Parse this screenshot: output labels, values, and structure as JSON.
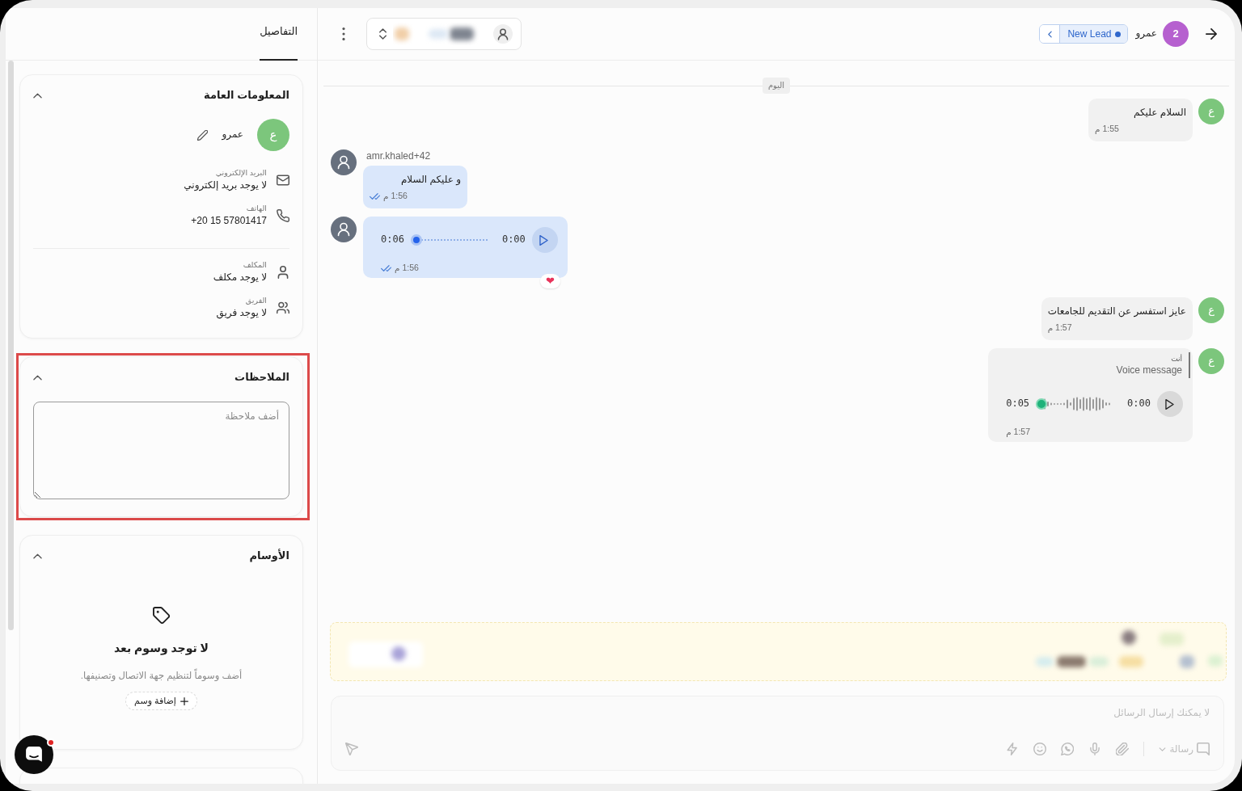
{
  "chat": {
    "header": {
      "avatar_text": "2",
      "name": "عمرو",
      "status": "New Lead"
    },
    "date_separator": "اليوم",
    "messages": [
      {
        "kind": "text",
        "outgoing": false,
        "avatar_letter": "ع",
        "text": "السلام عليكم",
        "time": "1:55 م",
        "read": false
      },
      {
        "kind": "text",
        "outgoing": true,
        "sender_name": "amr.khaled+42",
        "text": "و عليكم السلام",
        "time": "1:56 م",
        "read": true
      },
      {
        "kind": "voice",
        "outgoing": true,
        "player": {
          "kind": "dotted",
          "position": "0:00",
          "duration": "0:06",
          "level": 0
        },
        "time": "1:56 م",
        "read": true,
        "reaction": "❤"
      },
      {
        "kind": "text",
        "outgoing": false,
        "avatar_letter": "ع",
        "text": "عايز استفسر عن التقديم للجامعات",
        "time": "1:57 م",
        "read": false
      },
      {
        "kind": "voice",
        "outgoing": false,
        "avatar_letter": "ع",
        "reply_to": {
          "author": "أنت",
          "text": "Voice message"
        },
        "player": {
          "kind": "waveform",
          "position": "0:00",
          "duration": "0:05",
          "level": 0
        },
        "time": "1:57 م",
        "read": false
      }
    ],
    "composer": {
      "placeholder": "لا يمكنك إرسال الرسائل",
      "message_type": "رسالة",
      "disabled": true
    }
  },
  "details_panel": {
    "tabs": [
      {
        "label": "التفاصيل",
        "selected": true
      }
    ],
    "sections": [
      {
        "kind": "general",
        "title": "المعلومات العامة",
        "expanded": true,
        "highlighted": false,
        "contact": {
          "avatar_letter": "ع",
          "name": "عمرو"
        },
        "contact_fields": [
          {
            "kind": "email",
            "label": "البريد الإلكتروني",
            "value": "لا يوجد بريد إلكتروني"
          },
          {
            "kind": "phone",
            "label": "الهاتف",
            "value": "+20 15 57801417"
          }
        ],
        "assignment_fields": [
          {
            "kind": "assignee",
            "label": "المكلف",
            "value": "لا يوجد مكلف"
          },
          {
            "kind": "team",
            "label": "الفريق",
            "value": "لا يوجد فريق"
          }
        ]
      },
      {
        "kind": "notes",
        "title": "الملاحظات",
        "expanded": true,
        "highlighted": true,
        "placeholder": "أضف ملاحظة"
      },
      {
        "kind": "tags",
        "title": "الأوسام",
        "expanded": true,
        "highlighted": false,
        "empty_title": "لا توجد وسوم بعد",
        "empty_text": "أضف وسوماً لتنظيم جهة الاتصال وتصنيفها.",
        "add_button": "إضافة وسم"
      }
    ]
  }
}
